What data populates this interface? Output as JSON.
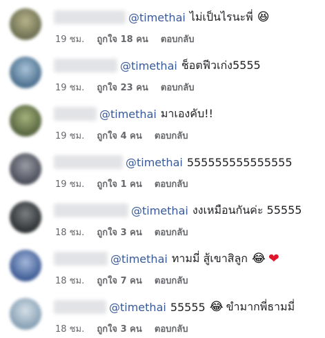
{
  "comments": [
    {
      "mention": "@timethai",
      "text": "ไม่เป็นไรนะพี่",
      "emoji": "😆",
      "heart": "",
      "time": "19 ชม.",
      "likes": "ถูกใจ 18 คน",
      "reply": "ตอบกลับ"
    },
    {
      "mention": "@timethai",
      "text": "ช็อตฟีวเก่ง5555",
      "emoji": "",
      "heart": "",
      "time": "19 ชม.",
      "likes": "ถูกใจ 23 คน",
      "reply": "ตอบกลับ"
    },
    {
      "mention": "@timethai",
      "text": "มาเองคับ!!",
      "emoji": "",
      "heart": "",
      "time": "19 ชม.",
      "likes": "ถูกใจ 4 คน",
      "reply": "ตอบกลับ"
    },
    {
      "mention": "@timethai",
      "text": "555555555555555",
      "emoji": "",
      "heart": "",
      "time": "19 ชม.",
      "likes": "ถูกใจ 1 คน",
      "reply": "ตอบกลับ"
    },
    {
      "mention": "@timethai",
      "text": "งงเหมือนกันค่ะ 55555",
      "emoji": "",
      "heart": "",
      "time": "18 ชม.",
      "likes": "ถูกใจ 3 คน",
      "reply": "ตอบกลับ"
    },
    {
      "mention": "@timethai",
      "text": "ทามมี่ สู้เขาสิลูก",
      "emoji": "😂",
      "heart": "❤",
      "time": "18 ชม.",
      "likes": "ถูกใจ 7 คน",
      "reply": "ตอบกลับ"
    },
    {
      "mention": "@timethai",
      "text": "55555",
      "emoji": "😂",
      "heart": "",
      "text2": "ขำมากพี่ธามมี่",
      "time": "18 ชม.",
      "likes": "ถูกใจ 3 คน",
      "reply": "ตอบกลับ"
    }
  ],
  "avatar_colors": [
    "#8a8f6a",
    "#5f84a3",
    "#7c8a5c",
    "#6a6e7a",
    "#4b4f52",
    "#5c78a8",
    "#9bb0c4"
  ]
}
